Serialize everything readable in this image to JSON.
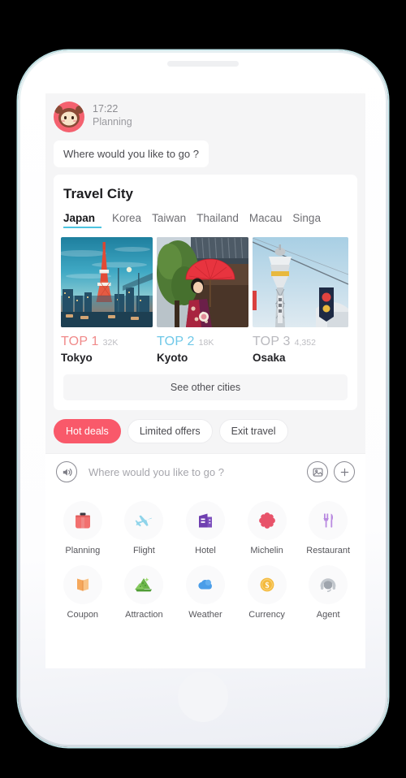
{
  "device": {
    "frame_name": "smartphone-mockup"
  },
  "chat": {
    "avatar_icon": "monkey-avatar",
    "time": "17:22",
    "sender": "Planning",
    "bot_message": "Where would you like to go ?"
  },
  "travel_card": {
    "title": "Travel City",
    "tabs": [
      {
        "label": "Japan",
        "active": true
      },
      {
        "label": "Korea",
        "active": false
      },
      {
        "label": "Taiwan",
        "active": false
      },
      {
        "label": "Thailand",
        "active": false
      },
      {
        "label": "Macau",
        "active": false
      },
      {
        "label": "Singa",
        "active": false
      }
    ],
    "active_tab_underline_color": "#4cc4e0",
    "cities": [
      {
        "rank": "TOP 1",
        "count": "32K",
        "name": "Tokyo",
        "rank_color": "#f08a8a",
        "image": "tokyo-tower-sunset"
      },
      {
        "rank": "TOP 2",
        "count": "18K",
        "name": "Kyoto",
        "rank_color": "#6fc8e8",
        "image": "kimono-woman-red-parasol"
      },
      {
        "rank": "TOP 3",
        "count": "4,352",
        "name": "Osaka",
        "rank_color": "#b9b9be",
        "image": "tsutenkaku-tower"
      }
    ],
    "see_other_cities": "See other cities"
  },
  "quick_replies": [
    {
      "label": "Hot deals",
      "primary": true
    },
    {
      "label": "Limited offers",
      "primary": false
    },
    {
      "label": "Exit travel",
      "primary": false
    }
  ],
  "composer": {
    "voice_icon": "voice-wave-icon",
    "placeholder": "Where would you like to go ?",
    "value": "",
    "image_icon": "image-picker-icon",
    "add_icon": "plus-icon"
  },
  "tools": {
    "row1": [
      {
        "label": "Planning",
        "icon": "suitcase-icon",
        "color": "#f2706f"
      },
      {
        "label": "Flight",
        "icon": "airplane-icon",
        "color": "#8fd4ea"
      },
      {
        "label": "Hotel",
        "icon": "building-icon",
        "color": "#6f3fb0"
      },
      {
        "label": "Michelin",
        "icon": "flower-icon",
        "color": "#e8536a"
      },
      {
        "label": "Restaurant",
        "icon": "fork-knife-icon",
        "color": "#b98ae0"
      }
    ],
    "row2": [
      {
        "label": "Coupon",
        "icon": "ticket-icon",
        "color": "#f5a85c"
      },
      {
        "label": "Attraction",
        "icon": "mountain-icon",
        "color": "#6cb54a"
      },
      {
        "label": "Weather",
        "icon": "cloud-icon",
        "color": "#4a9de8"
      },
      {
        "label": "Currency",
        "icon": "dollar-coin-icon",
        "color": "#f4ba3e"
      },
      {
        "label": "Agent",
        "icon": "headset-icon",
        "color": "#b9bcc2"
      }
    ]
  }
}
